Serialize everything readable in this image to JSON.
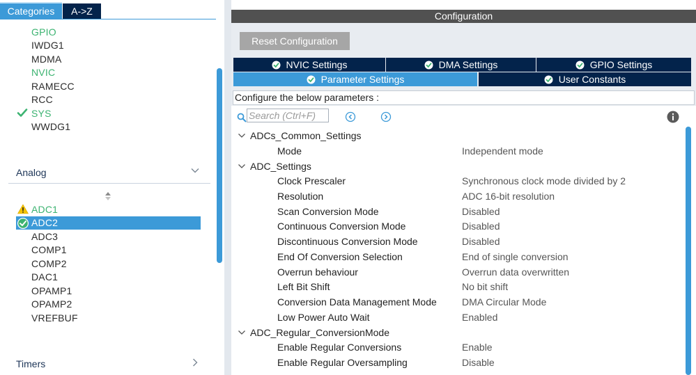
{
  "left_tabs": {
    "categories": "Categories",
    "az": "A->Z"
  },
  "system_core_items": [
    {
      "label": "GPIO",
      "state": "configured"
    },
    {
      "label": "IWDG1",
      "state": "default"
    },
    {
      "label": "MDMA",
      "state": "default"
    },
    {
      "label": "NVIC",
      "state": "configured"
    },
    {
      "label": "RAMECC",
      "state": "default"
    },
    {
      "label": "RCC",
      "state": "default"
    },
    {
      "label": "SYS",
      "state": "checked"
    },
    {
      "label": "WWDG1",
      "state": "default"
    }
  ],
  "analog": {
    "heading": "Analog",
    "items": [
      {
        "label": "ADC1",
        "state": "warning",
        "icon": "warning-icon"
      },
      {
        "label": "ADC2",
        "state": "selected",
        "icon": "check-circle-icon"
      },
      {
        "label": "ADC3",
        "state": "default"
      },
      {
        "label": "COMP1",
        "state": "default"
      },
      {
        "label": "COMP2",
        "state": "default"
      },
      {
        "label": "DAC1",
        "state": "default"
      },
      {
        "label": "OPAMP1",
        "state": "default"
      },
      {
        "label": "OPAMP2",
        "state": "default"
      },
      {
        "label": "VREFBUF",
        "state": "default"
      }
    ]
  },
  "timers": {
    "heading": "Timers"
  },
  "config": {
    "title": "Configuration",
    "reset_button": "Reset Configuration",
    "tabs": {
      "nvic": "NVIC Settings",
      "dma": "DMA Settings",
      "gpio": "GPIO Settings",
      "param": "Parameter Settings",
      "user": "User Constants"
    },
    "configure_text": "Configure the below parameters :",
    "search_placeholder": "Search (Ctrl+F)"
  },
  "params": {
    "group1": {
      "name": "ADCs_Common_Settings",
      "rows": [
        {
          "name": "Mode",
          "value": "Independent mode"
        }
      ]
    },
    "group2": {
      "name": "ADC_Settings",
      "rows": [
        {
          "name": "Clock Prescaler",
          "value": "Synchronous clock mode divided by 2"
        },
        {
          "name": "Resolution",
          "value": "ADC 16-bit resolution"
        },
        {
          "name": "Scan Conversion Mode",
          "value": "Disabled"
        },
        {
          "name": "Continuous Conversion Mode",
          "value": "Disabled"
        },
        {
          "name": "Discontinuous Conversion Mode",
          "value": "Disabled"
        },
        {
          "name": "End Of Conversion Selection",
          "value": "End of single conversion"
        },
        {
          "name": "Overrun behaviour",
          "value": "Overrun data overwritten"
        },
        {
          "name": "Left Bit Shift",
          "value": "No bit shift"
        },
        {
          "name": "Conversion Data Management Mode",
          "value": "DMA Circular Mode"
        },
        {
          "name": "Low Power Auto Wait",
          "value": "Enabled"
        }
      ]
    },
    "group3": {
      "name": "ADC_Regular_ConversionMode",
      "rows": [
        {
          "name": "Enable Regular Conversions",
          "value": "Enable"
        },
        {
          "name": "Enable Regular Oversampling",
          "value": "Disable"
        }
      ]
    }
  },
  "colors": {
    "accent": "#3c9ad8",
    "dark_tab": "#03234b",
    "config_bar": "#515151",
    "configured_green": "#3cb371",
    "warning_yellow": "#f5c400"
  }
}
